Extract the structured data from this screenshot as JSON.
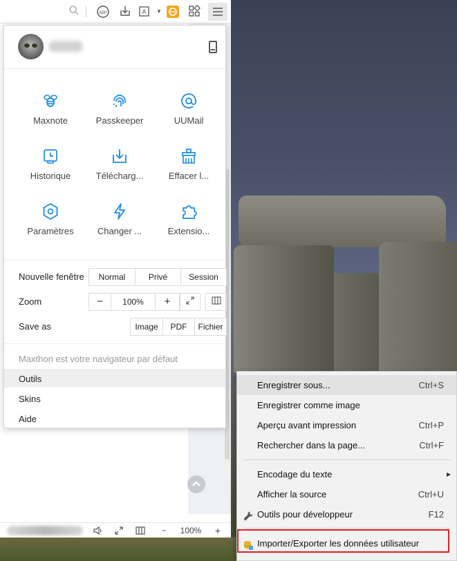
{
  "toolbar": {
    "icons": [
      "search-icon",
      "adblock-icon",
      "download-icon",
      "font-icon",
      "maxthon-sync-icon",
      "grid-icon",
      "hamburger-menu-icon"
    ],
    "adblock_text": "ABP"
  },
  "profile": {
    "device_icon": "device-icon"
  },
  "grid": [
    {
      "label": "Maxnote",
      "icon": "bee-icon"
    },
    {
      "label": "Passkeeper",
      "icon": "fingerprint-icon"
    },
    {
      "label": "UUMail",
      "icon": "at-icon"
    },
    {
      "label": "Historique",
      "icon": "history-icon"
    },
    {
      "label": "Télécharg...",
      "icon": "download-icon"
    },
    {
      "label": "Effacer l...",
      "icon": "broom-icon"
    },
    {
      "label": "Paramètres",
      "icon": "gear-icon"
    },
    {
      "label": "Changer ...",
      "icon": "lightning-icon"
    },
    {
      "label": "Extensio...",
      "icon": "puzzle-icon"
    }
  ],
  "window_row": {
    "label": "Nouvelle fenêtre",
    "options": [
      "Normal",
      "Privé",
      "Session"
    ]
  },
  "zoom_row": {
    "label": "Zoom",
    "minus": "−",
    "value": "100%",
    "plus": "+"
  },
  "saveas_row": {
    "label": "Save as",
    "options": [
      "Image",
      "PDF",
      "Fichier"
    ]
  },
  "bottom_menu": {
    "default_note": "Maxthon est votre navigateur par défaut",
    "outils": "Outils",
    "skins": "Skins",
    "aide": "Aide"
  },
  "submenu": {
    "items": [
      {
        "label": "Enregistrer sous...",
        "key": "Ctrl+S"
      },
      {
        "label": "Enregistrer comme image",
        "key": ""
      },
      {
        "label": "Aperçu avant impression",
        "key": "Ctrl+P"
      },
      {
        "label": "Rechercher dans la page...",
        "key": "Ctrl+F"
      },
      {
        "label": "Encodage du texte",
        "key": ""
      },
      {
        "label": "Afficher la source",
        "key": "Ctrl+U"
      },
      {
        "label": "Outils pour développeur",
        "key": "F12"
      },
      {
        "label": "Importer/Exporter les données utilisateur",
        "key": ""
      }
    ]
  },
  "statusbar": {
    "zoom_minus": "−",
    "zoom_value": "100%",
    "zoom_plus": "+"
  },
  "colors": {
    "accent_blue": "#1a8ce8",
    "highlight_red": "#e02020",
    "sync_orange": "#f5a623"
  }
}
